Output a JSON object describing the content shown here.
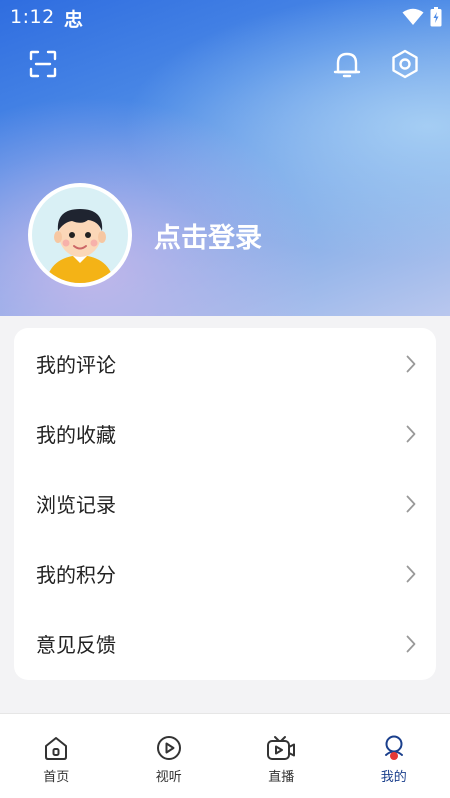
{
  "status_bar": {
    "time": "1:12",
    "app_glyph": "忠",
    "icons": [
      "wifi-icon",
      "battery-icon"
    ]
  },
  "header": {
    "icons": [
      "scan-icon",
      "bell-icon",
      "settings-hexagon-icon"
    ]
  },
  "profile": {
    "login_label": "点击登录",
    "avatar_icon": "cartoon-boy-avatar"
  },
  "menu": {
    "items": [
      {
        "label": "我的评论"
      },
      {
        "label": "我的收藏"
      },
      {
        "label": "浏览记录"
      },
      {
        "label": "我的积分"
      },
      {
        "label": "意见反馈"
      }
    ]
  },
  "tabbar": {
    "active": "我的",
    "active_color": "#1a3f8c",
    "items": [
      {
        "label": "首页",
        "icon": "home-icon"
      },
      {
        "label": "视听",
        "icon": "play-circle-icon"
      },
      {
        "label": "直播",
        "icon": "live-tv-icon"
      },
      {
        "label": "我的",
        "icon": "profile-icon"
      }
    ]
  }
}
